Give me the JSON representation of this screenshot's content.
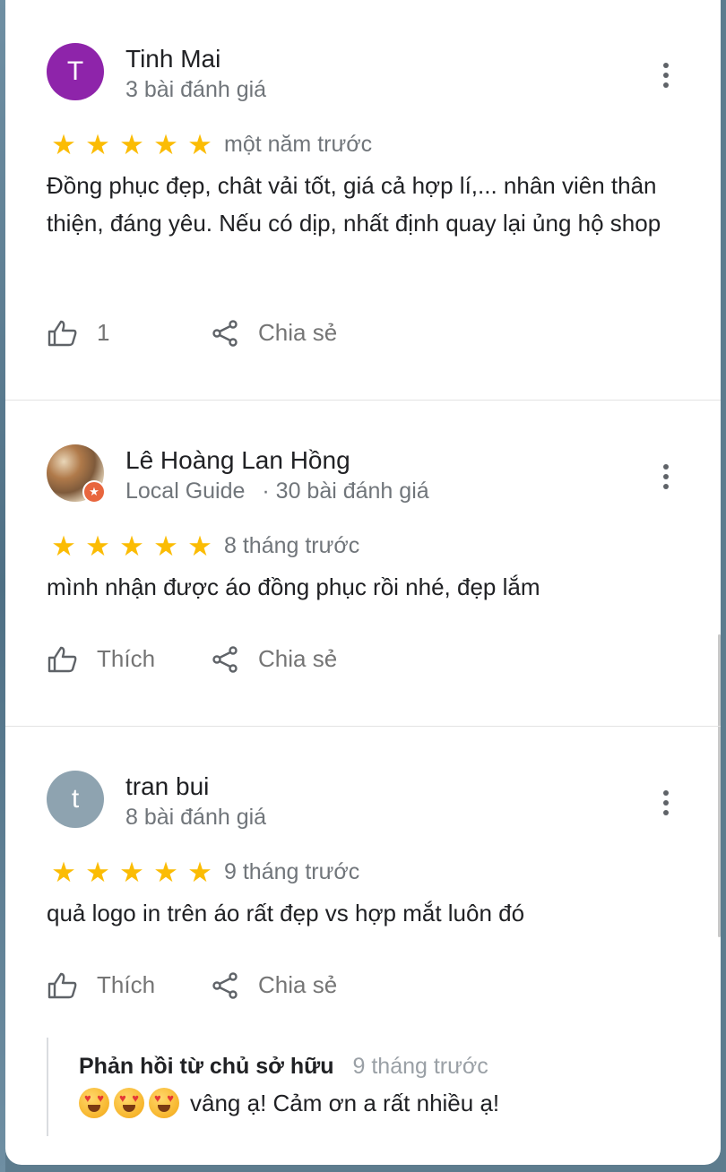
{
  "reviews": [
    {
      "avatar_letter": "T",
      "avatar_color": "#8e24aa",
      "name": "Tinh Mai",
      "meta": "3 bài đánh giá",
      "rating": 5,
      "time": "một năm trước",
      "text": "Đồng phục đẹp, chât vải tốt, giá cả hợp lí,... nhân viên thân thiện, đáng yêu. Nếu có dịp, nhất định quay lại ủng hộ shop",
      "like_label": "1",
      "share_label": "Chia sẻ"
    },
    {
      "avatar_letter": "",
      "name": "Lê Hoàng Lan Hồng",
      "badge": "Local Guide",
      "meta": "· 30 bài đánh giá",
      "rating": 5,
      "time": "8 tháng trước",
      "text": "mình nhận được áo đồng phục rồi nhé, đẹp lắm",
      "like_label": "Thích",
      "share_label": "Chia sẻ"
    },
    {
      "avatar_letter": "t",
      "avatar_color": "#8ea3b0",
      "name": "tran bui",
      "meta": "8 bài đánh giá",
      "rating": 5,
      "time": "9 tháng trước",
      "text": "quả logo in trên áo rất đẹp vs hợp mắt luôn đó",
      "like_label": "Thích",
      "share_label": "Chia sẻ",
      "owner_reply": {
        "title": "Phản hồi từ chủ sở hữu",
        "time": "9 tháng trước",
        "emoji": "heart-eyes",
        "text": "vâng ạ! Cảm ơn a rất nhiều ạ!"
      }
    }
  ],
  "colors": {
    "star": "#fbbc04",
    "text": "#202124",
    "secondary": "#70757a"
  }
}
